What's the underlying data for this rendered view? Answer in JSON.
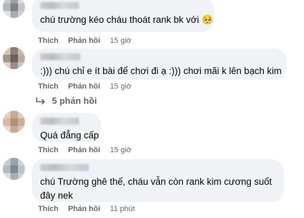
{
  "comments": [
    {
      "text": "chú trường kéo cháu thoát rank bk với 🥺",
      "actions": {
        "like": "Thích",
        "reply": "Phản hồi",
        "time": "15 giờ"
      }
    },
    {
      "text": ":))) chú chỉ e ít bài để chơi đi ạ :))) chơi mãi k lên bạch kim",
      "actions": {
        "like": "Thích",
        "reply": "Phản hồi",
        "time": "15 giờ"
      },
      "replies_label": "5 phản hồi"
    },
    {
      "text": "Quá đẳng cấp",
      "actions": {
        "like": "Thích",
        "reply": "Phản hồi",
        "time": "15 giờ"
      }
    },
    {
      "text": "chú Trường ghê thế, cháu vẫn còn rank kim cương suốt đây nek",
      "actions": {
        "like": "Thích",
        "reply": "Phản hồi",
        "time": "11 phút"
      }
    }
  ],
  "colors": {
    "bubble": "#f0f2f5",
    "meta": "#65676b",
    "text": "#050505"
  }
}
